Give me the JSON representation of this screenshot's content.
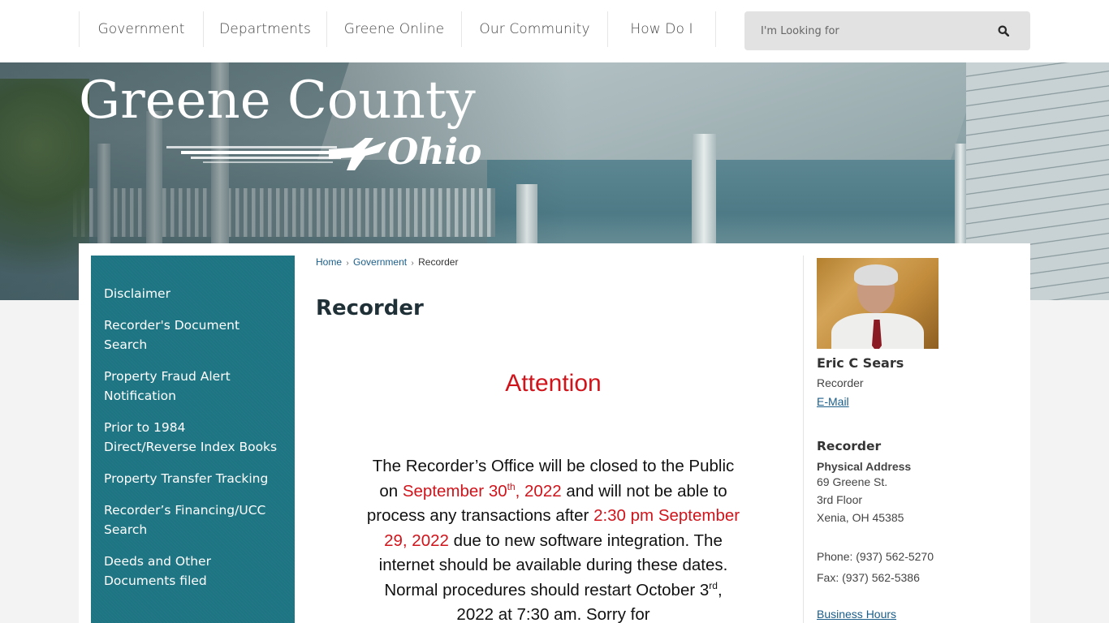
{
  "nav": {
    "items": [
      "Government",
      "Departments",
      "Greene Online",
      "Our Community",
      "How Do I"
    ]
  },
  "search": {
    "placeholder": "I'm Looking for",
    "value": ""
  },
  "banner": {
    "logo_title": "Greene County",
    "logo_subtitle": "Ohio"
  },
  "sidebar": {
    "items": [
      "Disclaimer",
      "Recorder's Document Search",
      "Property Fraud Alert Notification",
      "Prior to 1984 Direct/Reverse Index Books",
      "Property Transfer Tracking",
      "Recorder’s Financing/UCC Search",
      "Deeds and Other Documents filed"
    ]
  },
  "breadcrumb": {
    "home": "Home",
    "parent": "Government",
    "current": "Recorder",
    "separator": "›"
  },
  "main": {
    "title": "Recorder",
    "notice": {
      "heading": "Attention",
      "t1": "The Recorder’s Office will be closed to the Public on ",
      "r1": "September 30",
      "r1_sup": "th",
      "r1b": ", 2022",
      "t2": " and will not be able to process any transactions after ",
      "r2": "2:30 pm September 29, 2022",
      "t3": " due to new software integration. The internet should be available during these dates. Normal procedures should restart October 3",
      "t3_sup": "rd",
      "t4": ", 2022 at 7:30 am. Sorry for"
    }
  },
  "contact": {
    "name": "Eric C Sears",
    "title": "Recorder",
    "email_label": "E-Mail",
    "department": "Recorder",
    "address_label": "Physical Address",
    "address_lines": [
      "69 Greene St.",
      "3rd Floor",
      "Xenia, OH 45385"
    ],
    "phone": "Phone: (937) 562-5270",
    "fax": "Fax: (937) 562-5386",
    "hours_label": "Business Hours"
  },
  "colors": {
    "accent_teal": "#1d7482",
    "link_blue": "#1b5e8a",
    "alert_red": "#d0141b"
  }
}
